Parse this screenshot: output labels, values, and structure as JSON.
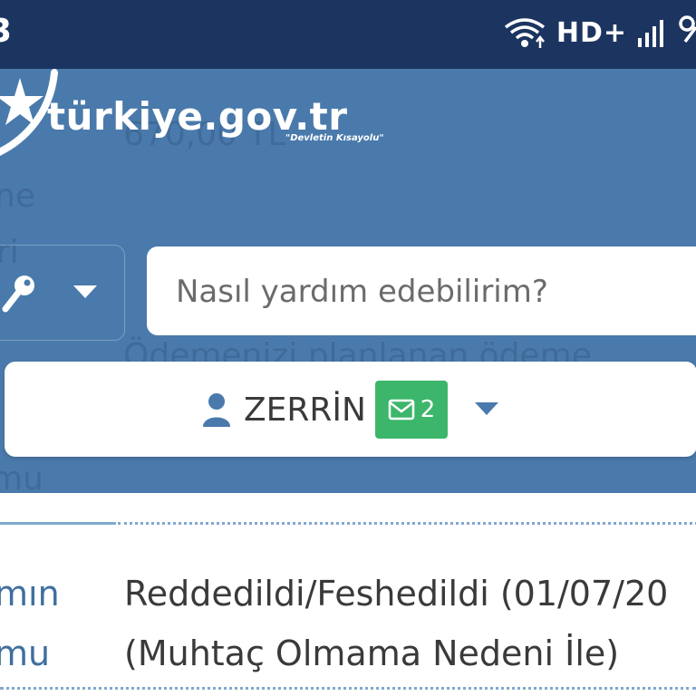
{
  "status_bar": {
    "time_partial": "3",
    "network": "HD+",
    "icons": [
      "wifi-icon",
      "signal-icon",
      "battery-icon"
    ]
  },
  "header": {
    "logo": {
      "title": "türkiye.gov.tr",
      "tagline": "\"Devletin Kısayolu\""
    },
    "search": {
      "placeholder": "Nasıl yardım edebilirim?"
    },
    "user": {
      "name": "ZERRİN",
      "mail_count": "2"
    },
    "background_text": [
      "670,00 TL",
      "ne",
      "ri",
      "Ödemenizi planlanan ödeme",
      "mu"
    ]
  },
  "content": {
    "row": {
      "label": [
        "mın",
        "mu"
      ],
      "value": [
        "Reddedildi/Feshedildi (01/07/20",
        "(Muhtaç Olmama Nedeni İle)"
      ]
    }
  },
  "colors": {
    "status_bar": "#1c3560",
    "header": "#4a7aab",
    "accent_green": "#3cb66b",
    "label_blue": "#3f6f9f"
  }
}
